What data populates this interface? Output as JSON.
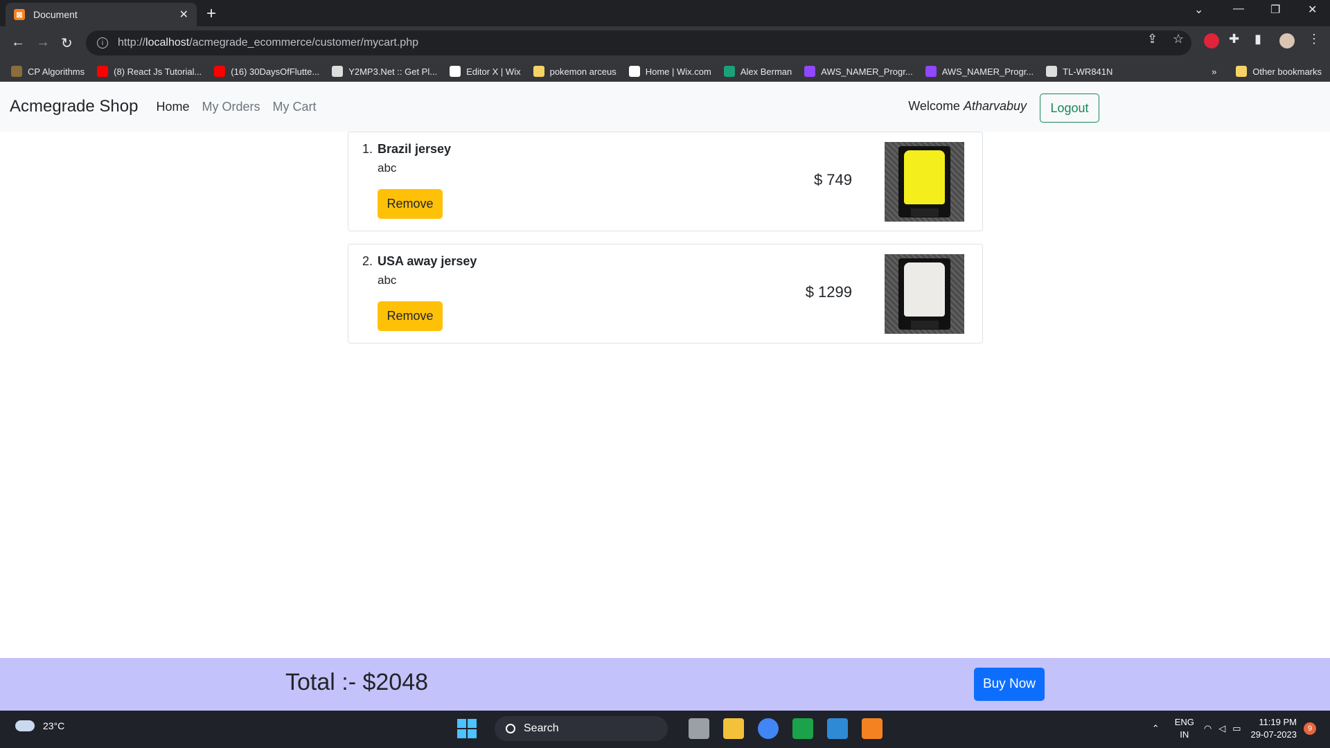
{
  "browser": {
    "tab_title": "Document",
    "url_prefix": "http://",
    "url_host": "localhost",
    "url_path": "/acmegrade_ecommerce/customer/mycart.php",
    "bookmarks": [
      {
        "label": "CP Algorithms",
        "color": "#8a6d3b"
      },
      {
        "label": "(8) React Js Tutorial...",
        "color": "#ff0000"
      },
      {
        "label": "(16) 30DaysOfFlutte...",
        "color": "#ff0000"
      },
      {
        "label": "Y2MP3.Net :: Get Pl...",
        "color": "#dddddd"
      },
      {
        "label": "Editor X | Wix",
        "color": "#ffffff"
      },
      {
        "label": "pokemon arceus",
        "color": "#f6d365"
      },
      {
        "label": "Home | Wix.com",
        "color": "#ffffff"
      },
      {
        "label": "Alex Berman",
        "color": "#1aa179"
      },
      {
        "label": "AWS_NAMER_Progr...",
        "color": "#9146ff"
      },
      {
        "label": "AWS_NAMER_Progr...",
        "color": "#9146ff"
      },
      {
        "label": "TL-WR841N",
        "color": "#dddddd"
      }
    ],
    "overflow": "»",
    "other_bookmarks": "Other bookmarks"
  },
  "navbar": {
    "brand": "Acmegrade Shop",
    "links": [
      "Home",
      "My Orders",
      "My Cart"
    ],
    "welcome": "Welcome",
    "username": "Atharvabuy",
    "logout": "Logout"
  },
  "cart": {
    "items": [
      {
        "num": "1.",
        "name": "Brazil jersey",
        "desc": "abc",
        "remove": "Remove",
        "price": "$ 749",
        "shirt_color": "#f4ee1c"
      },
      {
        "num": "2.",
        "name": "USA away jersey",
        "desc": "abc",
        "remove": "Remove",
        "price": "$ 1299",
        "shirt_color": "#ecebe8"
      }
    ]
  },
  "footer": {
    "total": "Total :- $2048",
    "buy": "Buy Now"
  },
  "taskbar": {
    "temp": "23°C",
    "search": "Search",
    "lang1": "ENG",
    "lang2": "IN",
    "time": "11:19 PM",
    "date": "29-07-2023",
    "notifications": "9"
  }
}
